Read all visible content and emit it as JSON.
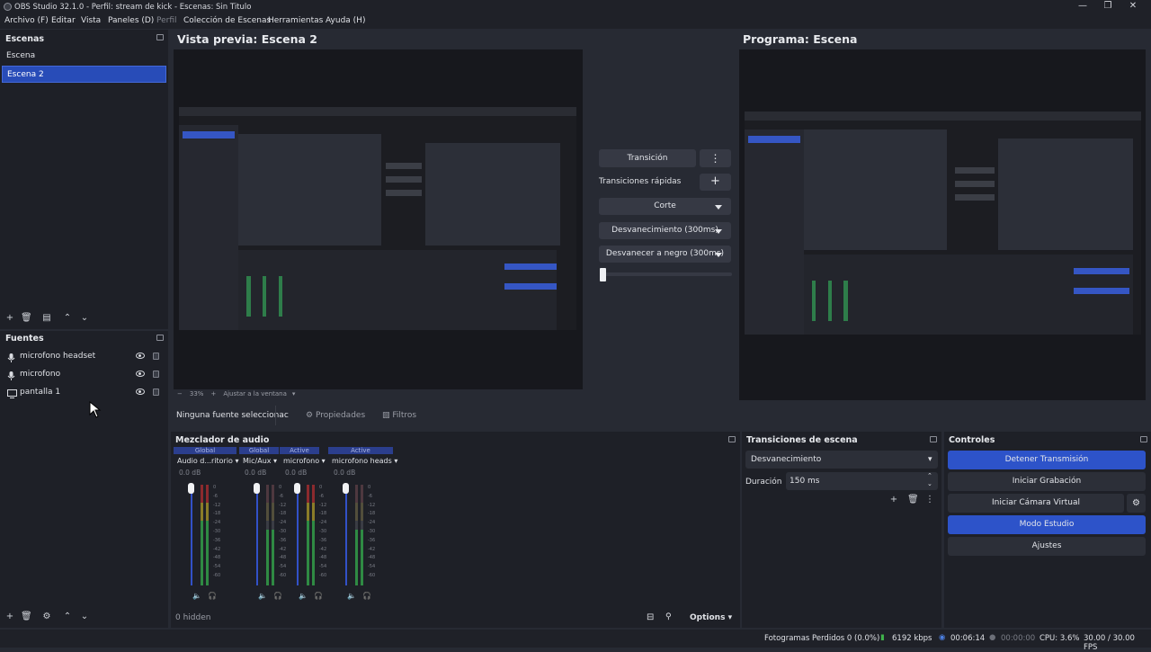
{
  "window": {
    "title": "OBS Studio 32.1.0 - Perfil: stream de kick - Escenas: Sin Titulo",
    "minimize": "—",
    "maximize": "❐",
    "close": "✕"
  },
  "menu": [
    {
      "label": "Archivo (F)"
    },
    {
      "label": "Editar"
    },
    {
      "label": "Vista"
    },
    {
      "label": "Paneles (D)"
    },
    {
      "label": "Perfil"
    },
    {
      "label": "Colección de Escenas"
    },
    {
      "label": "Herramientas"
    },
    {
      "label": "Ayuda (H)"
    }
  ],
  "scenes": {
    "title": "Escenas",
    "items": [
      "Escena",
      "Escena 2"
    ],
    "selected_index": 1
  },
  "sources": {
    "title": "Fuentes",
    "items": [
      {
        "name": "microfono headset",
        "icon": "microphone-icon"
      },
      {
        "name": "microfono",
        "icon": "microphone-icon"
      },
      {
        "name": "pantalla 1",
        "icon": "monitor-icon"
      }
    ]
  },
  "preview": {
    "title": "Vista previa: Escena 2",
    "zoom": "33%",
    "fit_label": "Ajustar a la ventana"
  },
  "program": {
    "title": "Programa: Escena"
  },
  "transitions_panel": {
    "transition_button": "Transición",
    "quick_label": "Transiciones rápidas",
    "items": [
      "Corte",
      "Desvanecimiento (300ms)",
      "Desvanecer a negro (300ms)"
    ]
  },
  "source_toolbar": {
    "none_selected": "Ninguna fuente seleccionac",
    "properties": "Propiedades",
    "filters": "Filtros"
  },
  "mixer": {
    "title": "Mezclador de audio",
    "hidden_label": "0 hidden",
    "options_label": "Options",
    "scale": [
      "0",
      "-6",
      "-12",
      "-18",
      "-24",
      "-30",
      "-36",
      "-42",
      "-48",
      "-54",
      "-60"
    ],
    "channels": [
      {
        "tag": "Global",
        "name": "Audio d...ritorio",
        "db": "0.0 dB",
        "level": 0.92
      },
      {
        "tag": "Global",
        "name": "Mic/Aux",
        "db": "0.0 dB",
        "level": 0.55
      },
      {
        "tag": "Active",
        "name": "microfono",
        "db": "0.0 dB",
        "level": 0.9
      },
      {
        "tag": "Active",
        "name": "microfono heads",
        "db": "0.0 dB",
        "level": 0.55
      }
    ]
  },
  "scene_transitions": {
    "title": "Transiciones de escena",
    "selected": "Desvanecimiento",
    "duration_label": "Duración",
    "duration_value": "150 ms"
  },
  "controls": {
    "title": "Controles",
    "buttons": [
      "Detener Transmisión",
      "Iniciar Grabación",
      "Iniciar Cámara Virtual",
      "Modo Estudio",
      "Ajustes"
    ]
  },
  "status": {
    "dropped": "Fotogramas Perdidos 0 (0.0%)",
    "kbps": "6192 kbps",
    "stream_time": "00:06:14",
    "rec_time": "00:00:00",
    "cpu": "CPU: 3.6%",
    "fps": "30.00 / 30.00 FPS"
  },
  "colors": {
    "accent": "#2d53c9",
    "background": "#272a33",
    "dock": "#1e2027"
  }
}
